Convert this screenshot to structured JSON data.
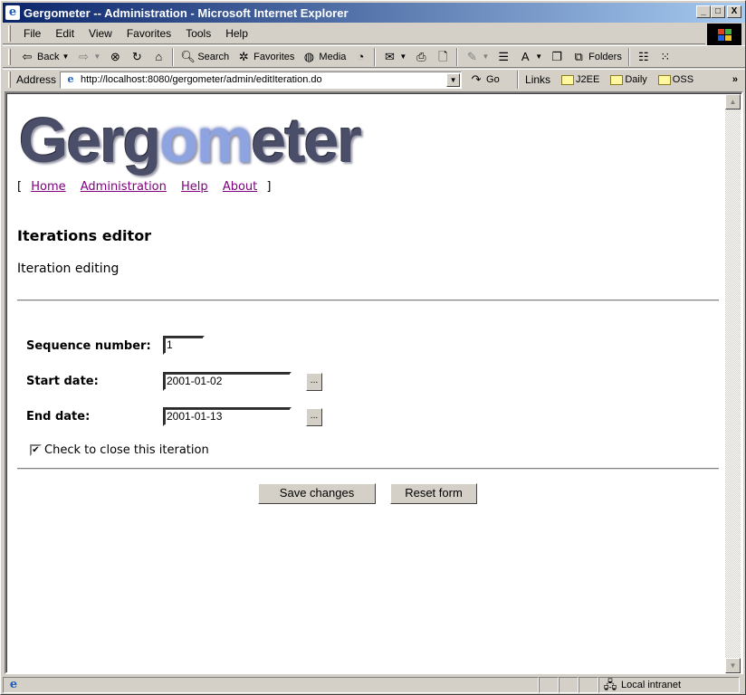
{
  "window": {
    "title": "Gergometer -- Administration - Microsoft Internet Explorer",
    "controls": {
      "minimize": "_",
      "maximize": "□",
      "close": "X"
    }
  },
  "menu": [
    "File",
    "Edit",
    "View",
    "Favorites",
    "Tools",
    "Help"
  ],
  "toolbar": {
    "back": "Back",
    "search": "Search",
    "favorites": "Favorites",
    "media": "Media",
    "folders": "Folders"
  },
  "address": {
    "label": "Address",
    "url": "http://localhost:8080/gergometer/admin/editIteration.do",
    "go": "Go",
    "links_label": "Links",
    "links": [
      "J2EE",
      "Daily",
      "OSS"
    ],
    "more": "»"
  },
  "page": {
    "logo": {
      "pre": "Gerg",
      "hl": "om",
      "post": "eter"
    },
    "nav": {
      "open": "[",
      "close": "]",
      "items": [
        "Home",
        "Administration",
        "Help",
        "About"
      ]
    },
    "heading": "Iterations editor",
    "subheading": "Iteration editing",
    "form": {
      "sequence_label": "Sequence number:",
      "sequence_value": "1",
      "start_label": "Start date:",
      "start_value": "2001-01-02",
      "end_label": "End date:",
      "end_value": "2001-01-13",
      "picker_label": "...",
      "close_checkbox_label": "Check to close this iteration",
      "close_checked": true,
      "save_label": "Save changes",
      "reset_label": "Reset form"
    }
  },
  "status": {
    "text": "",
    "zone": "Local intranet"
  }
}
